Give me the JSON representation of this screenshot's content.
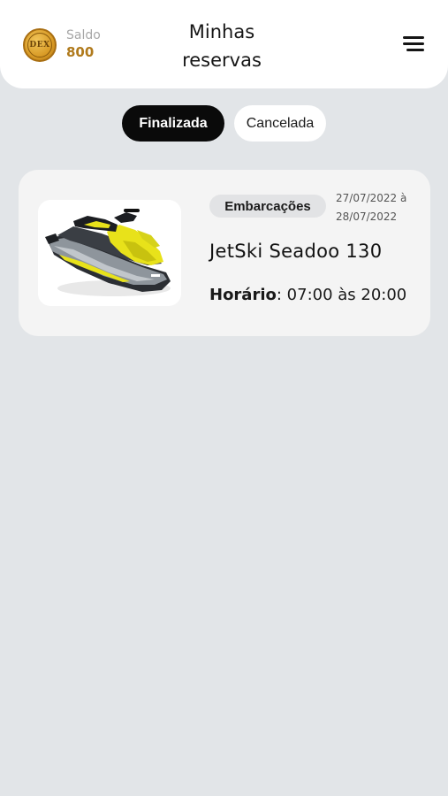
{
  "header": {
    "balance_label": "Saldo",
    "balance_value": "800",
    "coin_text": "DEX",
    "title_line1": "Minhas",
    "title_line2": "reservas",
    "menu_icon": "hamburger-menu-icon"
  },
  "tabs": [
    {
      "label": "Finalizada",
      "active": true
    },
    {
      "label": "Cancelada",
      "active": false
    }
  ],
  "reservations": [
    {
      "category": "Embarcações",
      "date_start": "27/07/2022 à",
      "date_end": "28/07/2022",
      "name": "JetSki Seadoo 130",
      "schedule_label": "Horário",
      "schedule_value": ": 07:00 às 20:00",
      "image_icon": "jetski-image"
    }
  ],
  "colors": {
    "background": "#e2e5e8",
    "accent_gold": "#b07a1c",
    "active_tab": "#0a0a0a",
    "jetski_yellow": "#e8e21a"
  }
}
